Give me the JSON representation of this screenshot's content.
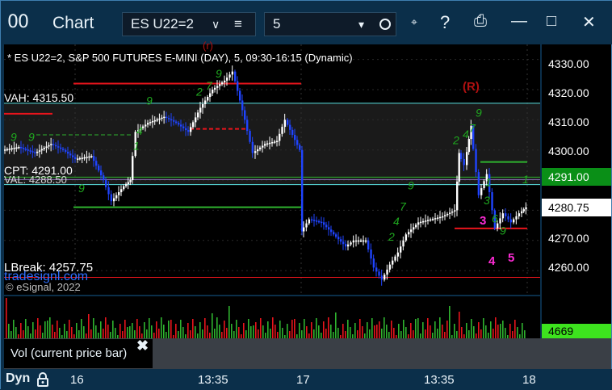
{
  "window": {
    "title": "Chart",
    "app_icon": "00",
    "symbol_value": "ES U22=2",
    "interval_value": "5",
    "toolbar_icons": [
      "menu-icon",
      "clock-icon",
      "pin-icon",
      "help-icon",
      "template-icon",
      "minimize-icon",
      "maximize-icon",
      "close-icon"
    ],
    "help_label": "?"
  },
  "chart": {
    "header": "* ES U22=2, S&P 500 FUTURES E-MINI (DAY), 5, 09:30-16:15 (Dynamic)",
    "vah": "VAH: 4315.50",
    "cpt": "CPT: 4291.00",
    "val": "VAL: 4288.50",
    "lbreak": "LBreak: 4257.75",
    "watermark": "tradesignl.com",
    "copyright": "© eSignal, 2022",
    "r_marker": "(R)",
    "tag_3": "3",
    "tag_4": "4",
    "tag_5": "5",
    "tag_r_partial": "(r)"
  },
  "scale": {
    "ticks": [
      "4330.00",
      "4320.00",
      "4310.00",
      "4300.00",
      "4290.00",
      "4280.00",
      "4270.00",
      "4260.00"
    ],
    "cpt_label": "4291.00",
    "last_label": "4280.75",
    "vol_label": "4669"
  },
  "footer": {
    "tooltip": "Vol (current price bar)",
    "close_glyph": "✖",
    "dyn": "Dyn",
    "time_labels": [
      "16",
      "13:35",
      "17",
      "13:35",
      "18"
    ]
  },
  "colors": {
    "bg": "#0b2f4a",
    "up": "#ffffff",
    "down": "#1f44ff",
    "red": "#e8141c",
    "cyan": "#58e0e0",
    "green": "#2fb32f",
    "cpt": "#0a8f17"
  },
  "chart_data": {
    "type": "candlestick",
    "yrange": [
      4252,
      4335
    ],
    "ticks": [
      4330,
      4320,
      4310,
      4300,
      4290,
      4280,
      4270,
      4260
    ],
    "levels": {
      "VAH": 4315.5,
      "CPT": 4291.0,
      "VAL": 4288.5,
      "LBreak": 4257.75,
      "last": 4280.75
    },
    "volume_last": 4669
  }
}
